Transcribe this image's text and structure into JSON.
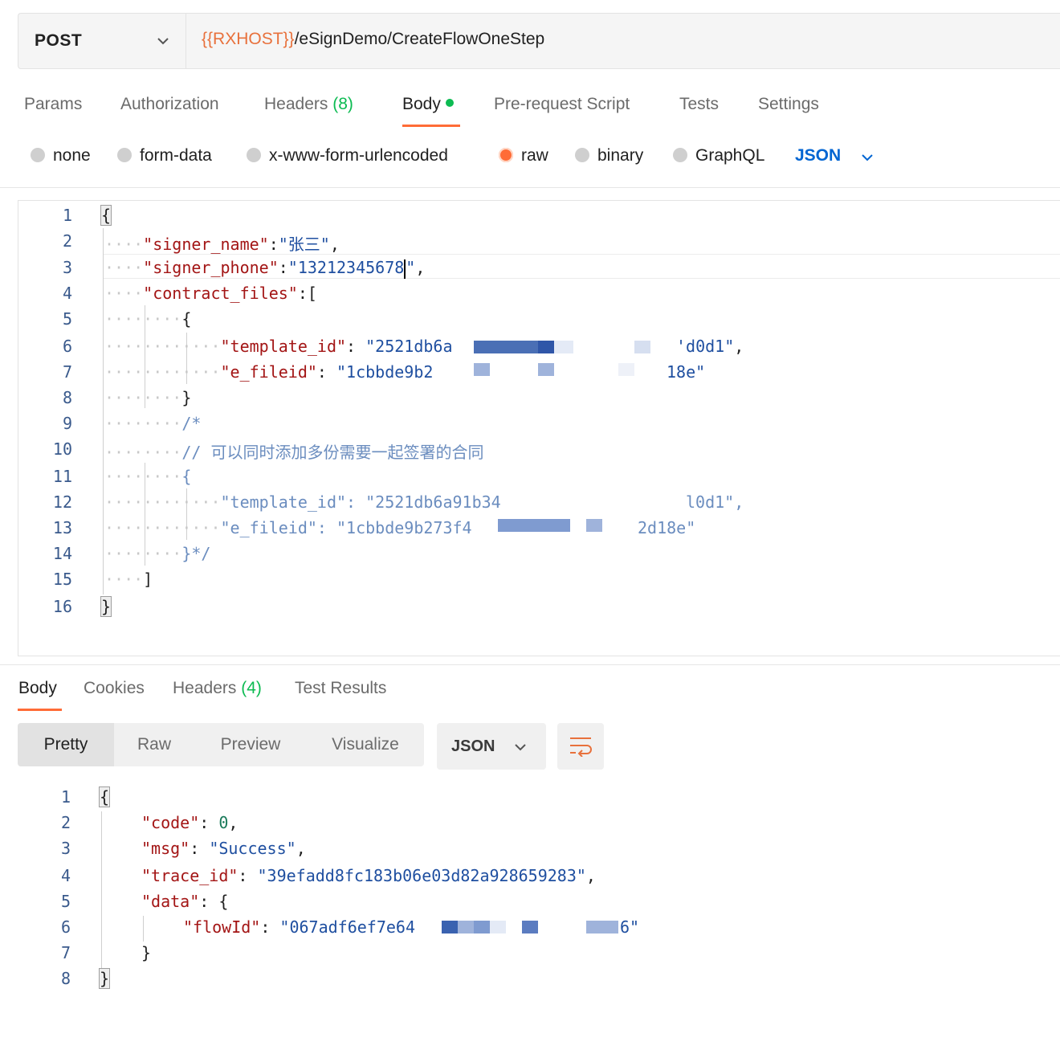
{
  "request": {
    "method": "POST",
    "url_var": "{{RXHOST}}",
    "url_path": "/eSignDemo/CreateFlowOneStep"
  },
  "request_tabs": [
    {
      "label": "Params"
    },
    {
      "label": "Authorization"
    },
    {
      "label": "Headers",
      "count": "(8)"
    },
    {
      "label": "Body"
    },
    {
      "label": "Pre-request Script"
    },
    {
      "label": "Tests"
    },
    {
      "label": "Settings"
    }
  ],
  "body_types": [
    "none",
    "form-data",
    "x-www-form-urlencoded",
    "raw",
    "binary",
    "GraphQL"
  ],
  "body_type_selected": "raw",
  "body_format": "JSON",
  "request_body": {
    "line_numbers": [
      "1",
      "2",
      "3",
      "4",
      "5",
      "6",
      "7",
      "8",
      "9",
      "10",
      "11",
      "12",
      "13",
      "14",
      "15",
      "16"
    ],
    "brace_open": "{",
    "brace_close": "}",
    "signer_name_key": "\"signer_name\"",
    "signer_name_val": "\"张三\"",
    "signer_phone_key": "\"signer_phone\"",
    "signer_phone_val": "\"13212345678",
    "signer_phone_end": "\"",
    "contract_files_key": "\"contract_files\"",
    "bracket_open": "[",
    "bracket_close": "]",
    "template_id_key": "\"template_id\"",
    "template_id_val_start": "\"2521db6a",
    "template_id_val_end": "'d0d1\"",
    "e_fileid_key": "\"e_fileid\"",
    "e_fileid_val_start": "\"1cbbde9b2",
    "e_fileid_val_end": "18e\"",
    "comment_open": "/*",
    "comment_text": "// 可以同时添加多份需要一起签署的合同",
    "comment_brace_open": "{",
    "c_template_id_key": "\"template_id\"",
    "c_template_id_val_start": "\"2521db6a91b34",
    "c_template_id_val_end": "l0d1\"",
    "c_e_fileid_key": "\"e_fileid\"",
    "c_e_fileid_val_start": "\"1cbbde9b273f4",
    "c_e_fileid_val_end": "2d18e\"",
    "comment_close": "}*/"
  },
  "response_tabs": [
    {
      "label": "Body"
    },
    {
      "label": "Cookies"
    },
    {
      "label": "Headers",
      "count": "(4)"
    },
    {
      "label": "Test Results"
    }
  ],
  "view_modes": [
    "Pretty",
    "Raw",
    "Preview",
    "Visualize"
  ],
  "response_format": "JSON",
  "response_body": {
    "line_numbers": [
      "1",
      "2",
      "3",
      "4",
      "5",
      "6",
      "7",
      "8"
    ],
    "brace_open": "{",
    "brace_close": "}",
    "code_key": "\"code\"",
    "code_val": "0",
    "msg_key": "\"msg\"",
    "msg_val": "\"Success\"",
    "trace_id_key": "\"trace_id\"",
    "trace_id_val": "\"39efadd8fc183b06e03d82a928659283\"",
    "data_key": "\"data\"",
    "flowId_key": "\"flowId\"",
    "flowId_val_start": "\"067adf6ef7e64",
    "flowId_val_end": "6\""
  },
  "colors": {
    "accent": "#ff6c37",
    "variable": "#e8713c",
    "green": "#0cbb52",
    "blue_link": "#0265d2",
    "json_key": "#a31515",
    "json_string": "#1f4fa0"
  }
}
